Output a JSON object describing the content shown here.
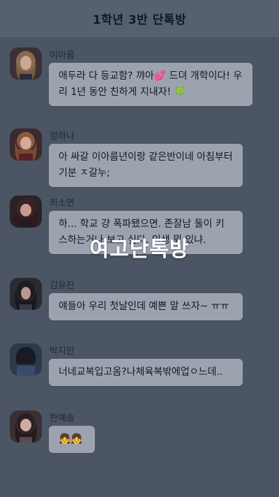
{
  "header": {
    "title": "1학년 3반 단톡방"
  },
  "overlay": {
    "title": "여고단톡방"
  },
  "messages": [
    {
      "name": "이아름",
      "text": "애두라 다 등교함? 꺄아💕 드뎌 개학이다! 우리 1년 동안 친하게 지내자! 🍀"
    },
    {
      "name": "정하나",
      "text": "아 싸갈 이아름년이랑 같은반이네 아침부터 기분 ㅈ갈누;"
    },
    {
      "name": "최소연",
      "text": "하... 학교 걍 폭파됐으면. 존잘남 둘이 키스하는거나 보고 싶다. 인생 뭐 있냐."
    },
    {
      "name": "김유진",
      "text": "얘들아 우리 첫날인데 예쁜 말 쓰자~ ㅠㅠ"
    },
    {
      "name": "박지민",
      "text": "너네교복입고옴?나체육복밖에업ㅇ느데.."
    },
    {
      "name": "한예솔",
      "text": "👧👧"
    }
  ],
  "colors": {
    "background": "#4b5563",
    "header_bg": "#566070",
    "bubble_bg": "#9ca3af",
    "text_dark": "#111827",
    "overlay_text": "#ffffff"
  }
}
